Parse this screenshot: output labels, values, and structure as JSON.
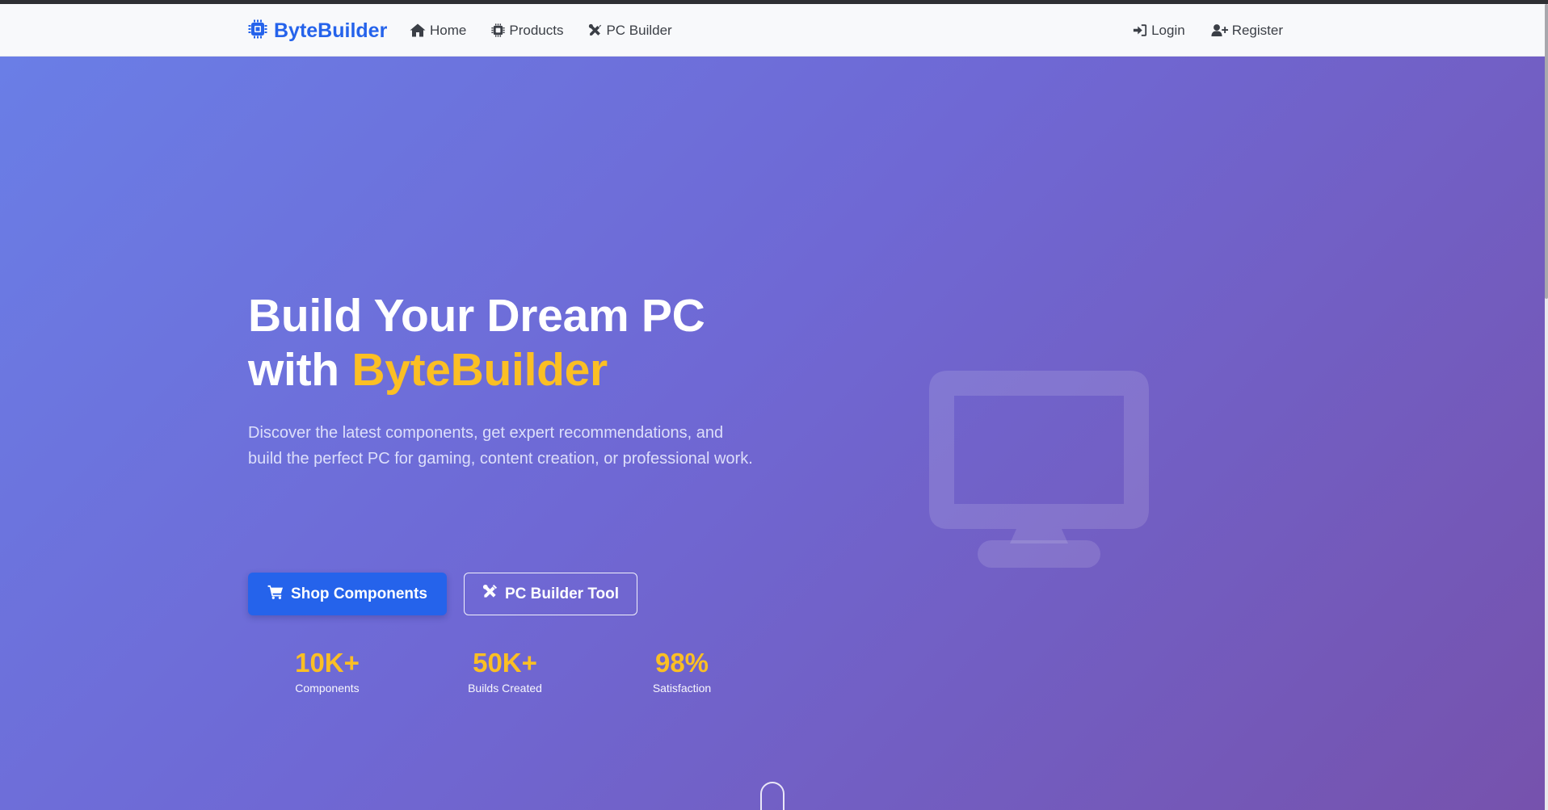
{
  "brand": {
    "name": "ByteBuilder",
    "icon": "cpu-chip-icon",
    "color": "#2563eb"
  },
  "nav": {
    "left": [
      {
        "label": "Home",
        "icon": "home-icon"
      },
      {
        "label": "Products",
        "icon": "microchip-icon"
      },
      {
        "label": "PC Builder",
        "icon": "tools-icon"
      }
    ],
    "right": [
      {
        "label": "Login",
        "icon": "sign-in-icon"
      },
      {
        "label": "Register",
        "icon": "user-plus-icon"
      }
    ]
  },
  "hero": {
    "title_line1": "Build Your Dream PC",
    "title_with": "with",
    "title_accent": "ByteBuilder",
    "description": "Discover the latest components, get expert recommendations, and build the perfect PC for gaming, content creation, or professional work.",
    "primary_button": {
      "label": "Shop Components",
      "icon": "cart-icon"
    },
    "secondary_button": {
      "label": "PC Builder Tool",
      "icon": "tools-icon"
    },
    "stats": [
      {
        "value": "10K+",
        "label": "Components"
      },
      {
        "value": "50K+",
        "label": "Builds Created"
      },
      {
        "value": "98%",
        "label": "Satisfaction"
      }
    ],
    "graphic_icon": "desktop-monitor-icon"
  },
  "colors": {
    "accent": "#fbbf24",
    "primary": "#2563eb",
    "gradient_start": "#6a7ee6",
    "gradient_end": "#7652ad"
  }
}
